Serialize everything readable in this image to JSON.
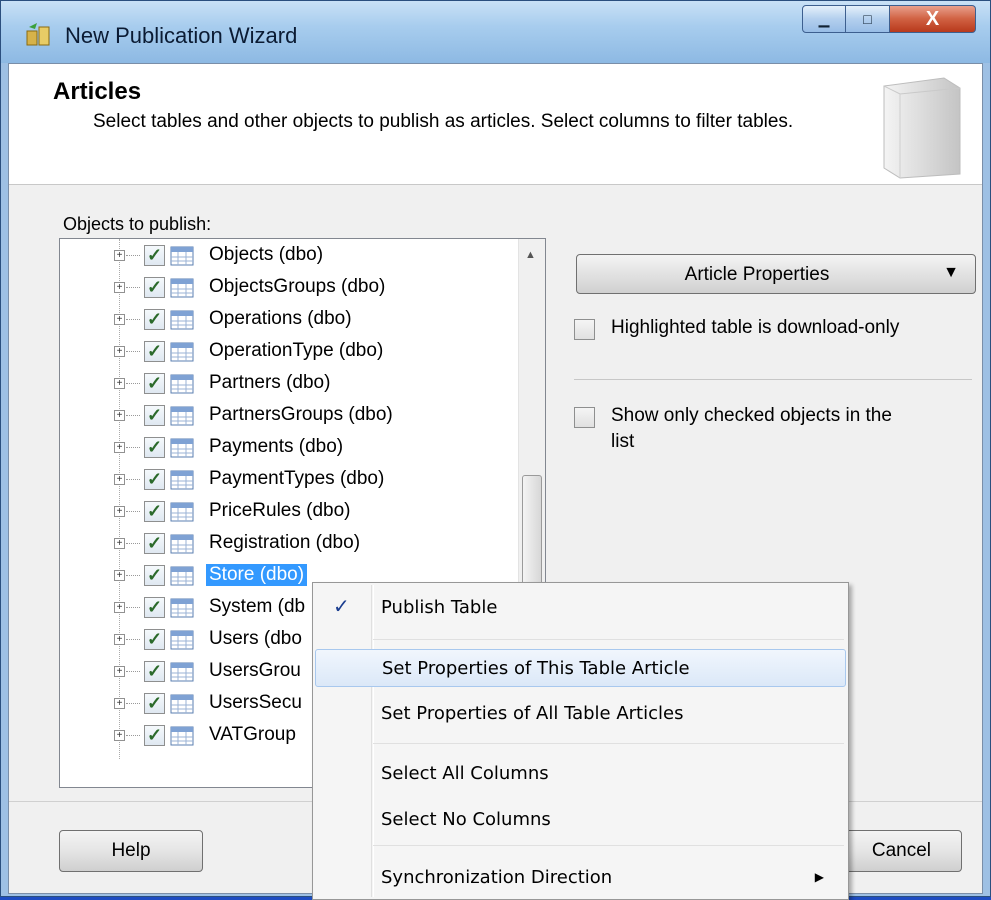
{
  "window": {
    "title": "New Publication Wizard",
    "caption_buttons": {
      "minimize": "▁",
      "maximize": "□",
      "close": "X"
    }
  },
  "header": {
    "title": "Articles",
    "description": "Select tables and other objects to publish as articles. Select columns to filter tables."
  },
  "objects_label": "Objects to publish:",
  "tree": {
    "items": [
      {
        "label": "Objects (dbo)",
        "checked": true
      },
      {
        "label": "ObjectsGroups (dbo)",
        "checked": true
      },
      {
        "label": "Operations (dbo)",
        "checked": true
      },
      {
        "label": "OperationType (dbo)",
        "checked": true
      },
      {
        "label": "Partners (dbo)",
        "checked": true
      },
      {
        "label": "PartnersGroups (dbo)",
        "checked": true
      },
      {
        "label": "Payments (dbo)",
        "checked": true
      },
      {
        "label": "PaymentTypes (dbo)",
        "checked": true
      },
      {
        "label": "PriceRules (dbo)",
        "checked": true
      },
      {
        "label": "Registration (dbo)",
        "checked": true
      },
      {
        "label": "Store (dbo)",
        "checked": true,
        "selected": true
      },
      {
        "label": "System (db",
        "checked": true
      },
      {
        "label": "Users (dbo",
        "checked": true
      },
      {
        "label": "UsersGrou",
        "checked": true
      },
      {
        "label": "UsersSecu",
        "checked": true
      },
      {
        "label": "VATGroup",
        "checked": true
      }
    ]
  },
  "right_panel": {
    "article_properties": "Article Properties",
    "download_only": "Highlighted table is download-only",
    "show_checked_line1": "Show only checked objects in the",
    "show_checked_line2": "list"
  },
  "footer": {
    "help": "Help",
    "cancel": "Cancel"
  },
  "context_menu": {
    "items": [
      {
        "label": "Publish Table",
        "checked": true
      },
      {
        "label": "Set Properties of This Table Article",
        "highlighted": true
      },
      {
        "label": "Set Properties of All Table Articles"
      },
      {
        "label": "Select All Columns"
      },
      {
        "label": "Select No Columns"
      },
      {
        "label": "Synchronization Direction",
        "submenu": true
      }
    ]
  },
  "colors": {
    "selection": "#3399ff",
    "desktop": "#2a5fd8",
    "menu_highlight_border": "#a8c8ee"
  }
}
